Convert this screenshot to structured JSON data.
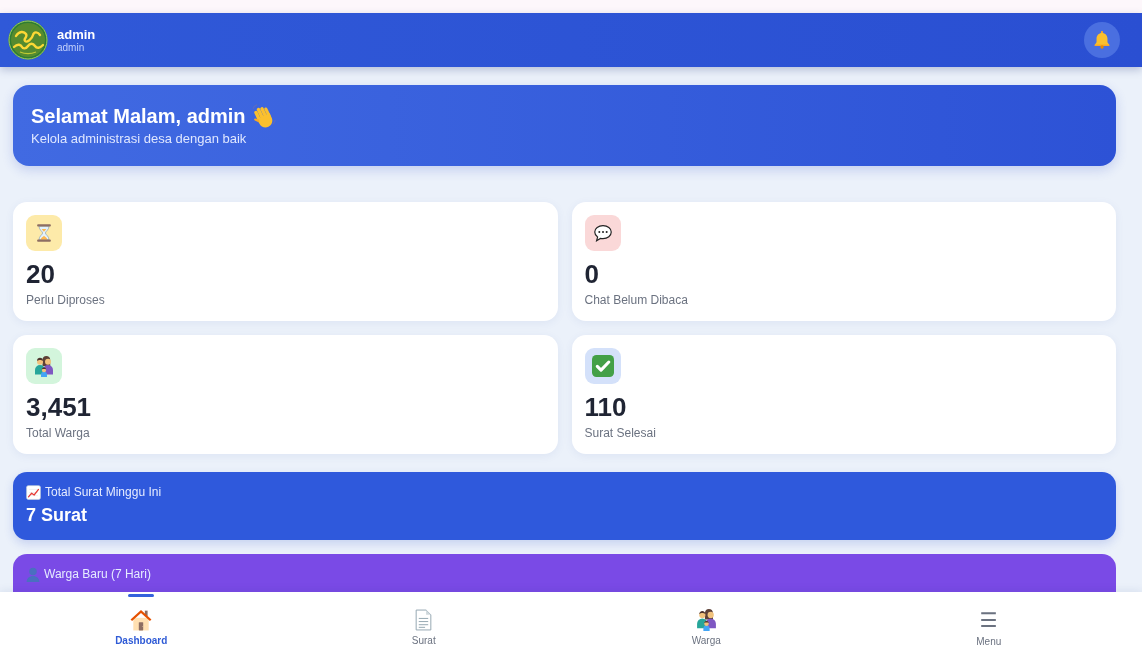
{
  "header": {
    "user_name": "admin",
    "user_role": "admin"
  },
  "greeting": {
    "title": "Selamat Malam, admin",
    "subtitle": "Kelola administrasi desa dengan baik"
  },
  "stats": [
    {
      "value": "20",
      "label": "Perlu Diproses",
      "color": "#fdeaa9"
    },
    {
      "value": "0",
      "label": "Chat Belum Dibaca",
      "color": "#fad8d8"
    },
    {
      "value": "3,451",
      "label": "Total Warga",
      "color": "#d3f5dc"
    },
    {
      "value": "110",
      "label": "Surat Selesai",
      "color": "#d4e1fa"
    }
  ],
  "summaries": [
    {
      "label": "Total Surat Minggu Ini",
      "value": "7 Surat",
      "color": "#2f59dc"
    },
    {
      "label": "Warga Baru (7 Hari)",
      "color": "#7a4ae6"
    }
  ],
  "bottom_nav": [
    {
      "label": "Dashboard",
      "selected": true
    },
    {
      "label": "Surat",
      "selected": false
    },
    {
      "label": "Warga",
      "selected": false
    },
    {
      "label": "Menu",
      "glyph": "☰",
      "selected": false
    }
  ]
}
